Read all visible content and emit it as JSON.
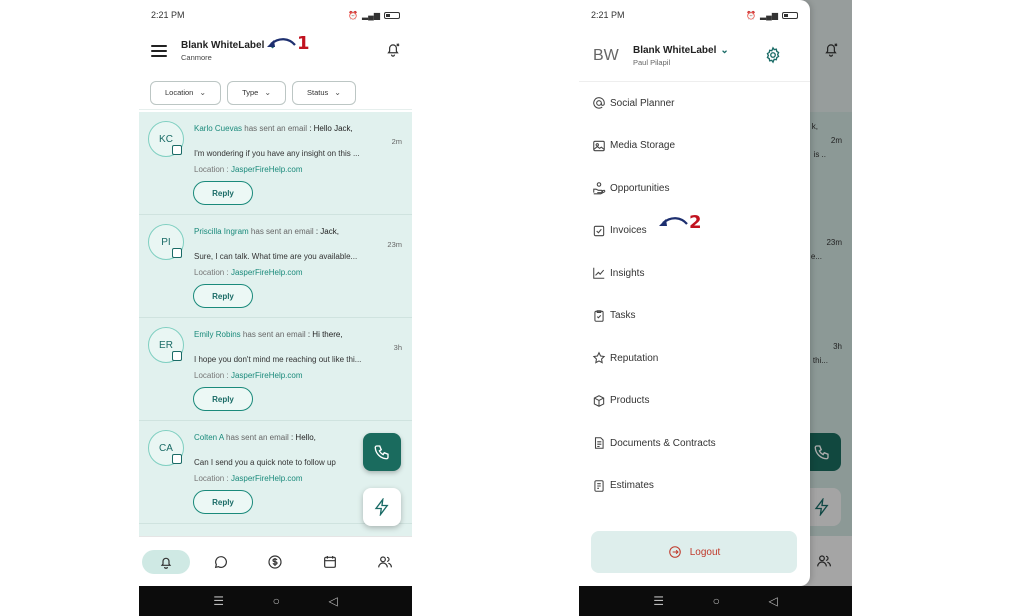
{
  "status": {
    "time": "2:21 PM"
  },
  "phone1": {
    "account": {
      "name": "Blank WhiteLabel",
      "location": "Canmore"
    },
    "marker": "1",
    "filters": [
      {
        "label": "Location"
      },
      {
        "label": "Type"
      },
      {
        "label": "Status"
      }
    ],
    "notifications": [
      {
        "initials": "KC",
        "name": "Karlo Cuevas",
        "action": "has sent an email",
        "subject": ": Hello Jack,",
        "time": "2m",
        "body": "I'm wondering if you have any insight on this ...",
        "location_label": "Location :",
        "location": "JasperFireHelp.com",
        "reply": "Reply"
      },
      {
        "initials": "PI",
        "name": "Priscilla Ingram",
        "action": "has sent an email",
        "subject": ": Jack,",
        "time": "23m",
        "body": "Sure, I can talk. What time are you available...",
        "location_label": "Location :",
        "location": "JasperFireHelp.com",
        "reply": "Reply"
      },
      {
        "initials": "ER",
        "name": "Emily Robins",
        "action": "has sent an email",
        "subject": ": Hi there,",
        "time": "3h",
        "body": "I hope you don't mind me reaching out like thi...",
        "location_label": "Location :",
        "location": "JasperFireHelp.com",
        "reply": "Reply"
      },
      {
        "initials": "CA",
        "name": "Colten A",
        "action": "has sent an email",
        "subject": ": Hello,",
        "time": "",
        "body": "Can I send you a quick note to follow up",
        "location_label": "Location :",
        "location": "JasperFireHelp.com",
        "reply": "Reply"
      }
    ]
  },
  "phone2": {
    "avatar_initials": "BW",
    "account": {
      "name": "Blank WhiteLabel",
      "user": "Paul Pilapil"
    },
    "marker": "2",
    "ghost_times": [
      "2m",
      "23m",
      "3h"
    ],
    "ghost_texts": [
      "k,",
      "is ..",
      "e...",
      "thi..."
    ],
    "menu": [
      {
        "label": "Social Planner",
        "icon": "at-sign-icon"
      },
      {
        "label": "Media Storage",
        "icon": "image-icon"
      },
      {
        "label": "Opportunities",
        "icon": "handshake-icon"
      },
      {
        "label": "Invoices",
        "icon": "invoice-icon"
      },
      {
        "label": "Insights",
        "icon": "trend-icon"
      },
      {
        "label": "Tasks",
        "icon": "clipboard-icon"
      },
      {
        "label": "Reputation",
        "icon": "star-icon"
      },
      {
        "label": "Products",
        "icon": "box-icon"
      },
      {
        "label": "Documents & Contracts",
        "icon": "document-icon"
      },
      {
        "label": "Estimates",
        "icon": "estimate-icon"
      }
    ],
    "logout": "Logout"
  },
  "colors": {
    "accent": "#1a6b66",
    "list_bg": "#e1f1ee",
    "marker": "#c1121f",
    "logout": "#c0392b"
  }
}
